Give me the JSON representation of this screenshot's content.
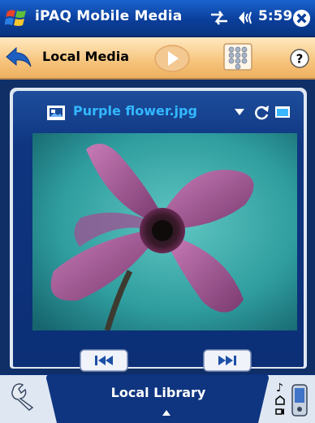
{
  "titlebar": {
    "app_title": "iPAQ Mobile Media",
    "time": "5:59",
    "icons": [
      "windows-start-icon",
      "sync-icon",
      "volume-icon",
      "close-icon"
    ]
  },
  "toolbar": {
    "location_title": "Local Media",
    "icons": [
      "back-arrow-icon",
      "play-icon",
      "keypad-icon",
      "help-icon"
    ]
  },
  "viewer": {
    "file_name": "Purple flower.jpg",
    "icons": [
      "image-file-icon",
      "dropdown-icon",
      "rotate-icon",
      "fullscreen-icon",
      "previous-icon",
      "next-icon"
    ]
  },
  "bottom": {
    "library_label": "Local Library",
    "icons": [
      "tools-icon",
      "up-arrow-icon",
      "device-icon"
    ]
  },
  "colors": {
    "titlebar_blue": "#0b3f9c",
    "toolbar_orange": "#f6c47c",
    "panel_navy": "#0f3580",
    "filename_cyan": "#33b8ff"
  }
}
